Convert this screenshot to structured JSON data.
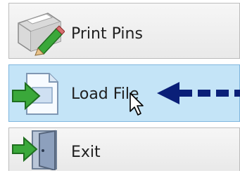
{
  "menu": {
    "items": [
      {
        "label": "Print Pins",
        "icon": "printer-icon",
        "state": "normal"
      },
      {
        "label": "Load File",
        "icon": "load-file-icon",
        "state": "hover"
      },
      {
        "label": "Exit",
        "icon": "exit-door-icon",
        "state": "normal"
      }
    ]
  },
  "annotation": {
    "arrow_icon": "dashed-arrow-left-icon",
    "arrow_color": "#0a1f78"
  },
  "colors": {
    "hover_background": "#c4e4f7",
    "hover_border": "#7fb6de",
    "item_background": "#efefef",
    "icon_green": "#3aa83a"
  }
}
